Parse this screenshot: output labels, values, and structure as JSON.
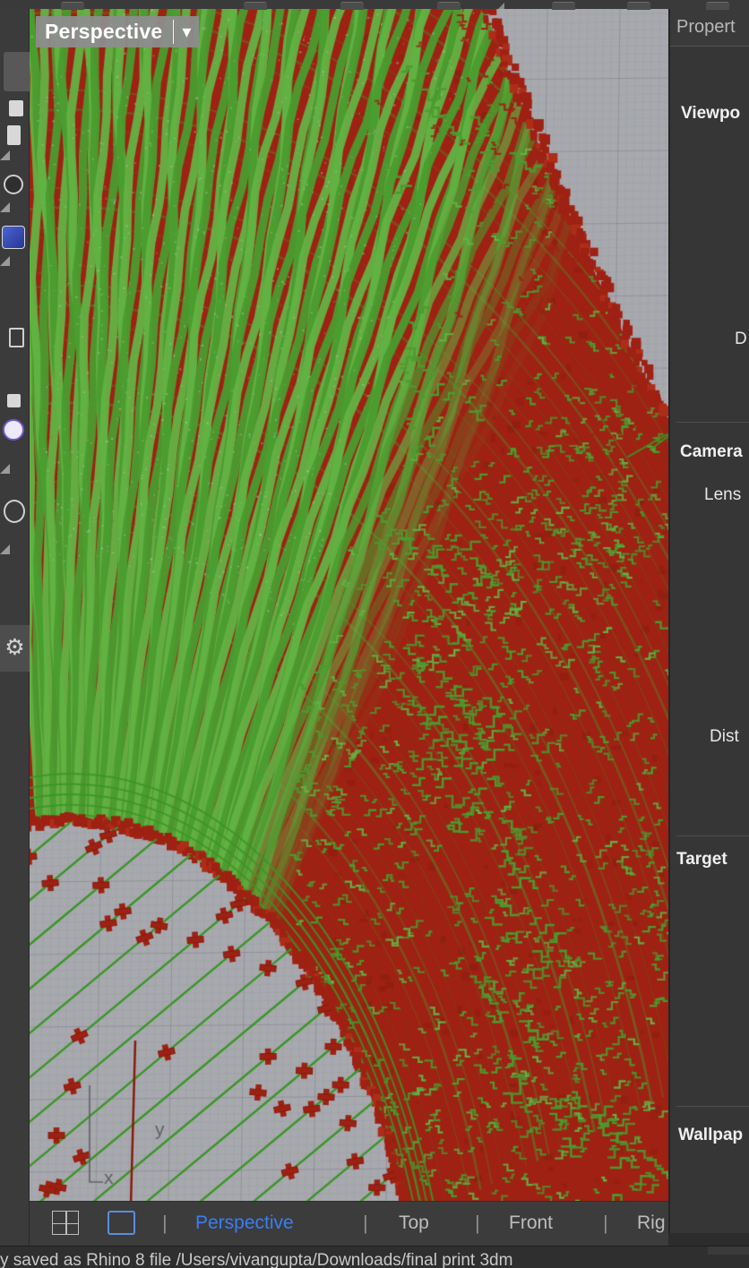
{
  "viewport": {
    "label": "Perspective",
    "caret_icon": "▾",
    "axis_labels": {
      "x": "x",
      "y": "y"
    },
    "colors": {
      "bg": "#a7a9ae",
      "grid_minor": "#94979c",
      "grid_major": "#7e8186",
      "red": "#9e2113",
      "red_dark": "#871a0e",
      "red_bright": "#ae2d18",
      "green": "#4a9c2f",
      "green_dark": "#3a9526",
      "green_light": "#63b244",
      "speck": "#c3c6ca",
      "axis": "#5f6165"
    }
  },
  "left_toolbar": {
    "gear_icon": "⚙"
  },
  "right_panel": {
    "tab_title": "Propert",
    "section_viewport": "Viewpo",
    "field_display": "D",
    "section_camera": "Camera",
    "field_lens": "Lens",
    "field_distance": "Dist",
    "section_target": "Target",
    "section_wallpaper": "Wallpap"
  },
  "viewport_tabs": {
    "separator": "|",
    "active_color": "#3b7ef2",
    "items": [
      {
        "label": "Perspective",
        "active": true
      },
      {
        "label": "Top",
        "active": false
      },
      {
        "label": "Front",
        "active": false
      },
      {
        "label": "Rig",
        "active": false
      }
    ]
  },
  "status_bar": {
    "text": "y saved as Rhino 8 file /Users/vivangupta/Downloads/final print 3dm"
  }
}
